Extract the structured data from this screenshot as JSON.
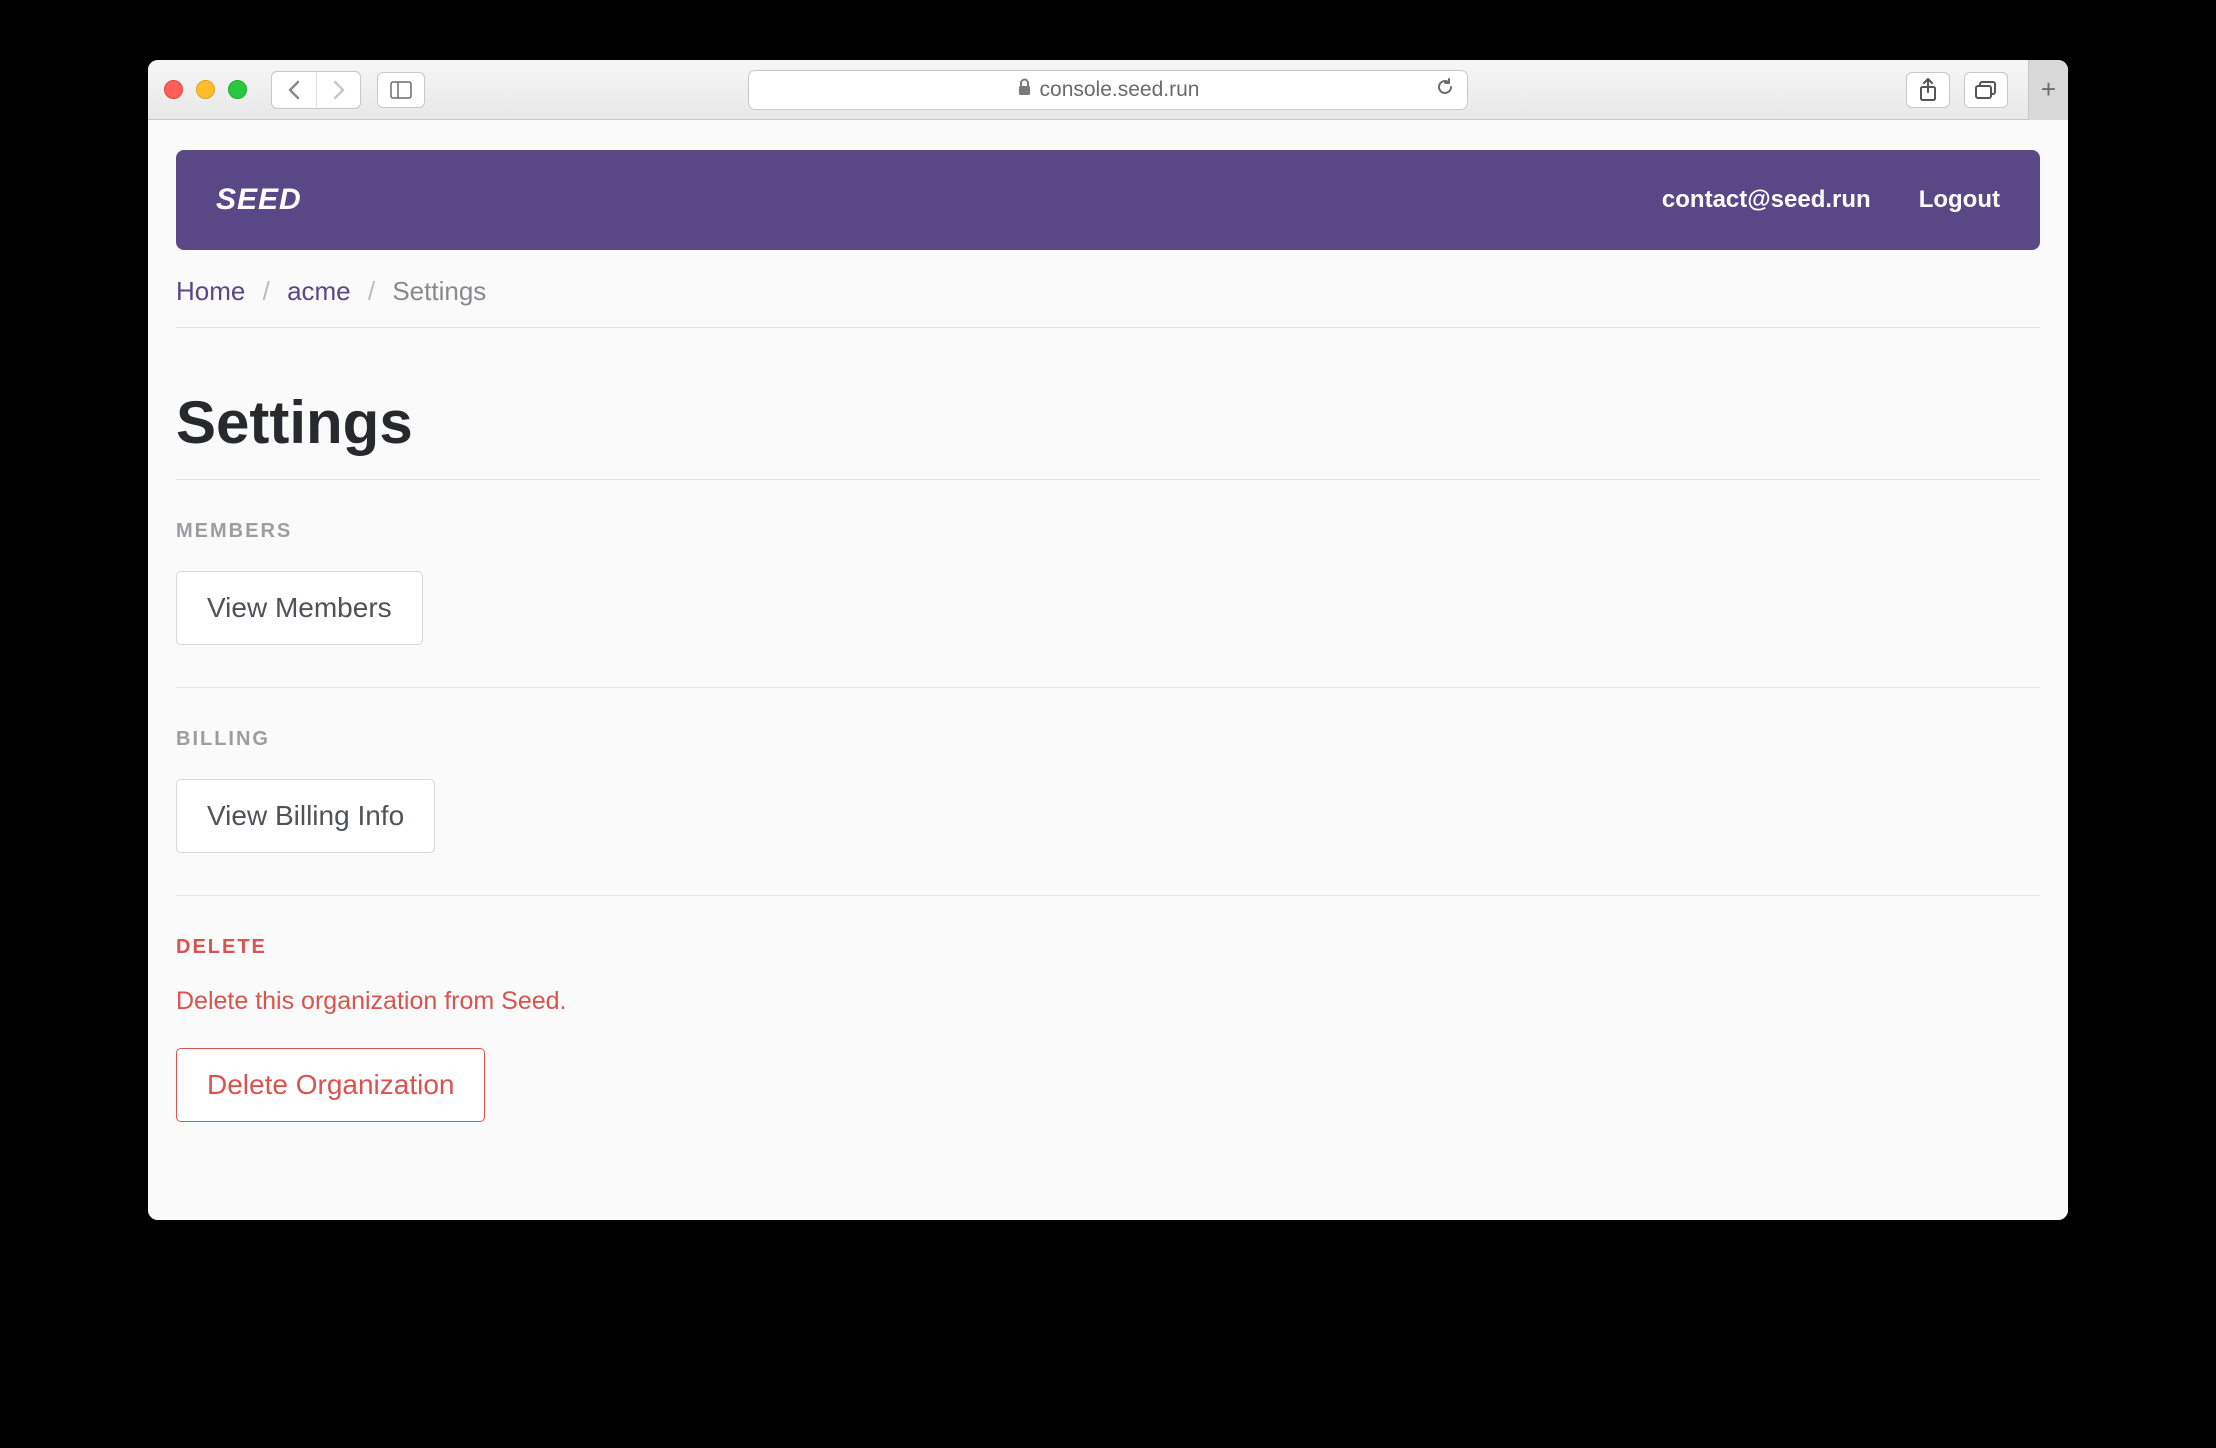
{
  "browser": {
    "url": "console.seed.run"
  },
  "header": {
    "logo": "SEED",
    "email": "contact@seed.run",
    "logout": "Logout"
  },
  "breadcrumb": {
    "home": "Home",
    "org": "acme",
    "current": "Settings"
  },
  "page": {
    "title": "Settings"
  },
  "sections": {
    "members": {
      "label": "MEMBERS",
      "button": "View Members"
    },
    "billing": {
      "label": "BILLING",
      "button": "View Billing Info"
    },
    "delete": {
      "label": "DELETE",
      "desc": "Delete this organization from Seed.",
      "button": "Delete Organization"
    }
  }
}
